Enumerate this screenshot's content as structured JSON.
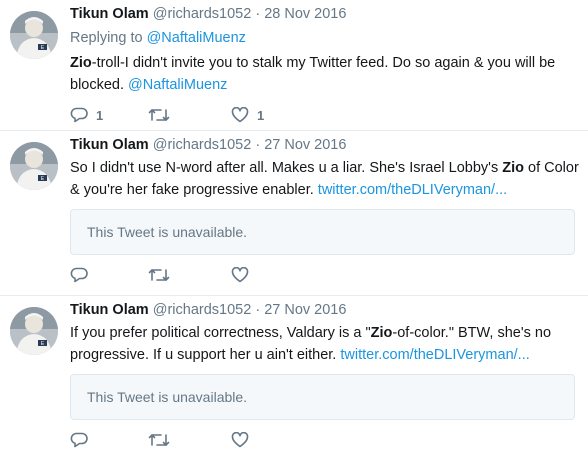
{
  "colors": {
    "link": "#1b95e0",
    "muted": "#657786",
    "text": "#14171a",
    "border": "#e6ecf0"
  },
  "tweets": [
    {
      "name": "Tikun Olam",
      "handle": "@richards1052",
      "separator": "·",
      "date": "28 Nov 2016",
      "replying_label": "Replying to",
      "replying_to": "@NaftaliMuenz",
      "text_bold_1": "Zio",
      "text_1": "-troll-I didn't  invite you to stalk my Twitter feed. Do so again & you will be blocked. ",
      "mention": "@NaftaliMuenz",
      "reply_count": "1",
      "retweet_count": "",
      "like_count": "1",
      "icons": [
        "reply-icon",
        "retweet-icon",
        "heart-icon"
      ]
    },
    {
      "name": "Tikun Olam",
      "handle": "@richards1052",
      "separator": "·",
      "date": "27 Nov 2016",
      "text_1": "So I didn't use N-word after all.  Makes u a liar. She's Israel Lobby's ",
      "text_bold_1": "Zio",
      "text_2": " of Color & you're her fake progressive enabler. ",
      "link": "twitter.com/theDLIVeryman/...",
      "quote_text": "This Tweet is unavailable.",
      "icons": [
        "reply-icon",
        "retweet-icon",
        "heart-icon"
      ]
    },
    {
      "name": "Tikun Olam",
      "handle": "@richards1052",
      "separator": "·",
      "date": "27 Nov 2016",
      "text_1": "If you prefer political correctness, Valdary is a \"",
      "text_bold_1": "Zio",
      "text_2": "-of-color.\"  BTW, she's no progressive. If u support her u ain't either. ",
      "link": "twitter.com/theDLIVeryman/...",
      "quote_text": "This Tweet is unavailable.",
      "icons": [
        "reply-icon",
        "retweet-icon",
        "heart-icon"
      ]
    }
  ]
}
